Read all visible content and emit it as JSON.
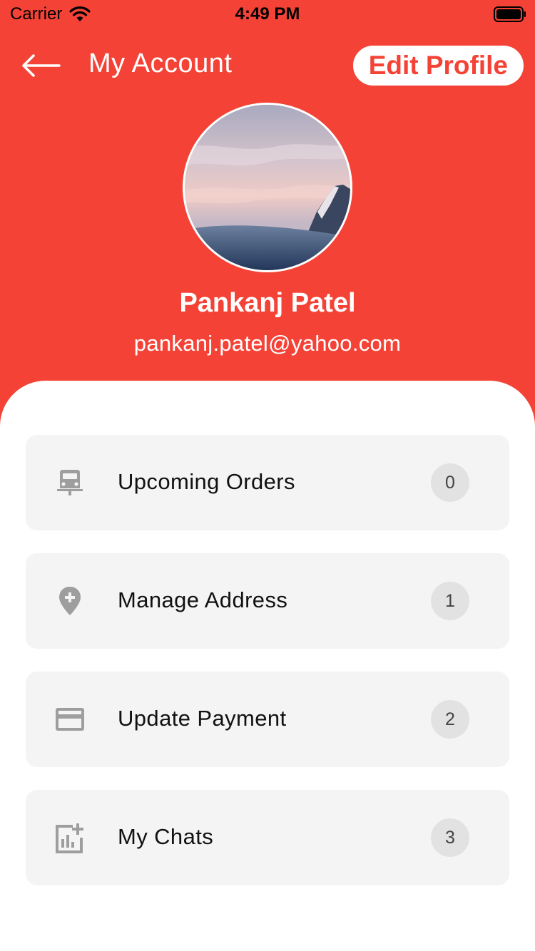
{
  "status_bar": {
    "carrier": "Carrier",
    "time": "4:49 PM"
  },
  "app_bar": {
    "title": "My Account",
    "edit_profile_label": "Edit Profile"
  },
  "profile": {
    "name": "Pankanj Patel",
    "email": "pankanj.patel@yahoo.com"
  },
  "menu": {
    "items": [
      {
        "label": "Upcoming Orders",
        "count": "0",
        "icon": "car-icon"
      },
      {
        "label": "Manage Address",
        "count": "1",
        "icon": "location-add-icon"
      },
      {
        "label": "Update Payment",
        "count": "2",
        "icon": "credit-card-icon"
      },
      {
        "label": "My Chats",
        "count": "3",
        "icon": "chart-add-icon"
      }
    ]
  },
  "colors": {
    "primary": "#F44336",
    "card": "#F4F4F4",
    "badge": "#E2E2E2"
  }
}
